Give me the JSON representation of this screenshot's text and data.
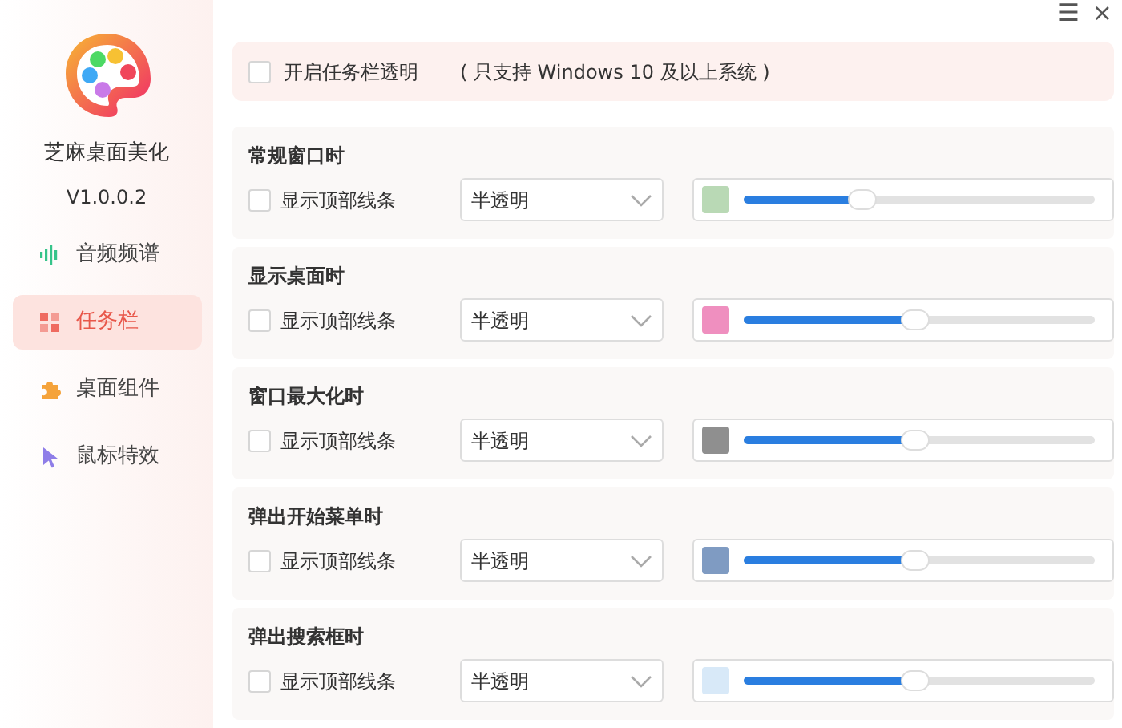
{
  "app": {
    "name": "芝麻桌面美化",
    "version": "V1.0.0.2"
  },
  "sidebar": {
    "items": [
      {
        "label": "音频频谱",
        "kind": "audio",
        "selected": false
      },
      {
        "label": "任务栏",
        "kind": "taskbar",
        "selected": true
      },
      {
        "label": "桌面组件",
        "kind": "widget",
        "selected": false
      },
      {
        "label": "鼠标特效",
        "kind": "cursor",
        "selected": false
      }
    ]
  },
  "window_controls": [
    "☰",
    "×"
  ],
  "banner": {
    "label": "开启任务栏透明",
    "checked": false,
    "note": "( 只支持 Windows 10 及以上系统 )"
  },
  "sections": [
    {
      "title": "常规窗口时",
      "checkbox_label": "显示顶部线条",
      "checked": false,
      "mode": "半透明",
      "color": "#b9d9b5",
      "level": 0.34
    },
    {
      "title": "显示桌面时",
      "checkbox_label": "显示顶部线条",
      "checked": false,
      "mode": "半透明",
      "color": "#ef8fbf",
      "level": 0.49
    },
    {
      "title": "窗口最大化时",
      "checkbox_label": "显示顶部线条",
      "checked": false,
      "mode": "半透明",
      "color": "#8f8f8f",
      "level": 0.49
    },
    {
      "title": "弹出开始菜单时",
      "checkbox_label": "显示顶部线条",
      "checked": false,
      "mode": "半透明",
      "color": "#7f9bc2",
      "level": 0.49
    },
    {
      "title": "弹出搜索框时",
      "checkbox_label": "显示顶部线条",
      "checked": false,
      "mode": "半透明",
      "color": "#d8e9f8",
      "level": 0.49
    }
  ]
}
